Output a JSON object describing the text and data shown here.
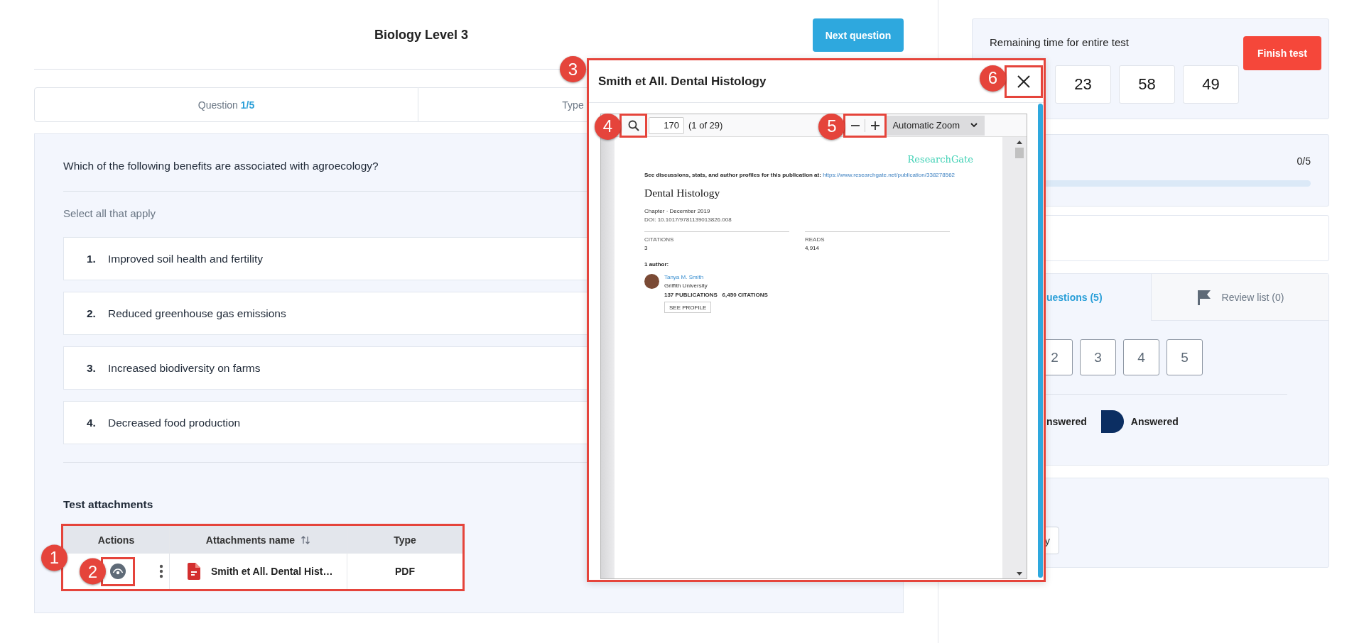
{
  "header": {
    "title": "Biology Level 3",
    "next_button": "Next question"
  },
  "info_bar": {
    "question_label": "Question",
    "question_count": "1/5",
    "type_label": "Type"
  },
  "question": {
    "text": "Which of the following benefits are associated with agroecology?",
    "instruction": "Select all that apply",
    "options": [
      {
        "number": "1.",
        "text": "Improved soil health and fertility"
      },
      {
        "number": "2.",
        "text": "Reduced greenhouse gas emissions"
      },
      {
        "number": "3.",
        "text": "Increased biodiversity on farms"
      },
      {
        "number": "4.",
        "text": "Decreased food production"
      }
    ]
  },
  "attachments": {
    "title": "Test attachments",
    "callout": "1",
    "columns": [
      {
        "label": "Actions",
        "sortable": false
      },
      {
        "label": "Attachments name",
        "sortable": true
      },
      {
        "label": "Type",
        "sortable": false
      }
    ],
    "rows": [
      {
        "view_callout": "2",
        "name": "Smith et All. Dental Hist…",
        "type": "PDF"
      }
    ]
  },
  "timer": {
    "label": "Remaining time for entire test",
    "values": [
      "23",
      "58",
      "49"
    ],
    "finish_button": "Finish test"
  },
  "progress": {
    "count": "0/5",
    "level": 0
  },
  "question_nav": {
    "tabs": [
      {
        "label": "uestions (5)",
        "selected": true
      },
      {
        "label": "Review list (0)",
        "selected": false
      }
    ],
    "numbers": [
      "2",
      "3",
      "4",
      "5"
    ],
    "legend": [
      {
        "label": "nswered",
        "kind": "unanswered"
      },
      {
        "label": "Answered",
        "kind": "answered"
      }
    ]
  },
  "bottom_card": {
    "button": "y"
  },
  "modal": {
    "title": "Smith et All. Dental Histology",
    "callout": "3",
    "close_callout": "6",
    "viewer": {
      "search_callout": "4",
      "page": "170",
      "page_count": "(1 of 29)",
      "zoom_callout": "5",
      "zoom_mode": "Automatic Zoom",
      "document": {
        "brand": "ResearchGate",
        "notice": "See discussions, stats, and author profiles for this publication at:",
        "notice_link": "https://www.researchgate.net/publication/338278562",
        "title": "Dental Histology",
        "meta": "Chapter · December 2019",
        "doi": "DOI: 10.1017/9781139013826.008",
        "stats": [
          {
            "label": "CITATIONS",
            "value": "3"
          },
          {
            "label": "READS",
            "value": "4,914"
          }
        ],
        "authors_label": "1 author:",
        "author": {
          "name": "Tanya M. Smith",
          "affiliation": "Griffith University",
          "counts": "137 PUBLICATIONS   6,450 CITATIONS",
          "profile_button": "SEE PROFILE"
        }
      }
    }
  }
}
